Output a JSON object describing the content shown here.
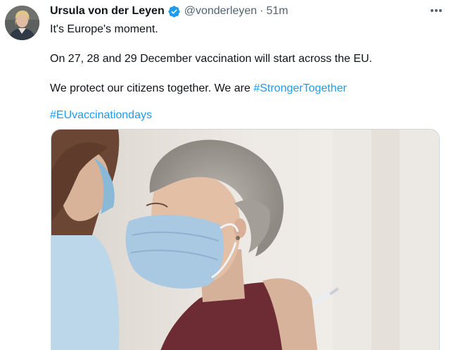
{
  "tweet": {
    "author_name": "Ursula von der Leyen",
    "handle": "@vonderleyen",
    "separator": "·",
    "time": "51m",
    "text_line1": "It's Europe's moment.",
    "text_line2": "On 27, 28 and 29 December vaccination will start across the EU.",
    "text_line3_prefix": "We protect our citizens together. We are ",
    "hashtag1": "#StrongerTogether",
    "hashtag2": "#EUvaccinationdays"
  },
  "colors": {
    "link": "#1d9bf0",
    "verified_badge": "#1d9bf0",
    "secondary_text": "#536471"
  },
  "icons": {
    "verified": "verified-badge-icon",
    "more": "more-options-icon"
  }
}
